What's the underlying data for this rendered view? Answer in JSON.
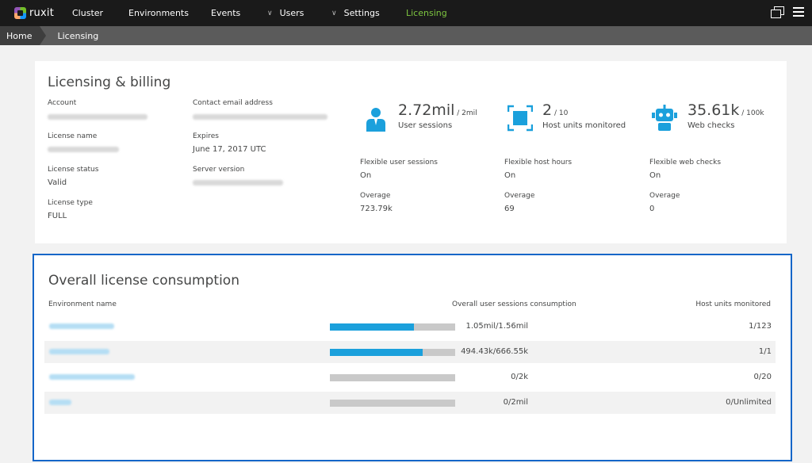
{
  "nav": {
    "logo": "ruxit",
    "items": [
      {
        "label": "Cluster",
        "chevron": false,
        "active": false
      },
      {
        "label": "Environments",
        "chevron": false,
        "active": false
      },
      {
        "label": "Events",
        "chevron": false,
        "active": false
      },
      {
        "label": "Users",
        "chevron": true,
        "active": false
      },
      {
        "label": "Settings",
        "chevron": true,
        "active": false
      },
      {
        "label": "Licensing",
        "chevron": false,
        "active": true
      }
    ],
    "icons": [
      "window-switch-icon",
      "hamburger-menu-icon"
    ]
  },
  "breadcrumb": {
    "home": "Home",
    "current": "Licensing"
  },
  "billing": {
    "title": "Licensing & billing",
    "account_label": "Account",
    "license_name_label": "License name",
    "license_status_label": "License status",
    "license_status_value": "Valid",
    "license_type_label": "License type",
    "license_type_value": "FULL",
    "contact_label": "Contact email address",
    "expires_label": "Expires",
    "expires_value": "June 17, 2017 UTC",
    "server_version_label": "Server version",
    "metrics": [
      {
        "icon": "user-sessions-icon",
        "value": "2.72mil",
        "limit": " / 2mil",
        "caption": "User sessions",
        "flex_label": "Flexible user sessions",
        "flex_value": "On",
        "overage_label": "Overage",
        "overage_value": "723.79k"
      },
      {
        "icon": "host-units-icon",
        "value": "2",
        "limit": " / 10",
        "caption": "Host units monitored",
        "flex_label": "Flexible host hours",
        "flex_value": "On",
        "overage_label": "Overage",
        "overage_value": "69"
      },
      {
        "icon": "web-checks-robot-icon",
        "value": "35.61k",
        "limit": " / 100k",
        "caption": "Web checks",
        "flex_label": "Flexible web checks",
        "flex_value": "On",
        "overage_label": "Overage",
        "overage_value": "0"
      }
    ]
  },
  "consumption": {
    "title": "Overall license consumption",
    "col_env": "Environment name",
    "col_sessions": "Overall user sessions consumption",
    "col_hosts": "Host units monitored",
    "rows": [
      {
        "sessions": "1.05mil/1.56mil",
        "fill": 0.67,
        "hosts": "1/123"
      },
      {
        "sessions": "494.43k/666.55k",
        "fill": 0.74,
        "hosts": "1/1"
      },
      {
        "sessions": "0/2k",
        "fill": 0,
        "hosts": "0/20"
      },
      {
        "sessions": "0/2mil",
        "fill": 0,
        "hosts": "0/Unlimited"
      }
    ]
  },
  "colors": {
    "nav_bg": "#1a1a1a",
    "active_nav": "#7dc540",
    "accent_blue": "#1ba0dc",
    "focus_border": "#1566c8"
  }
}
